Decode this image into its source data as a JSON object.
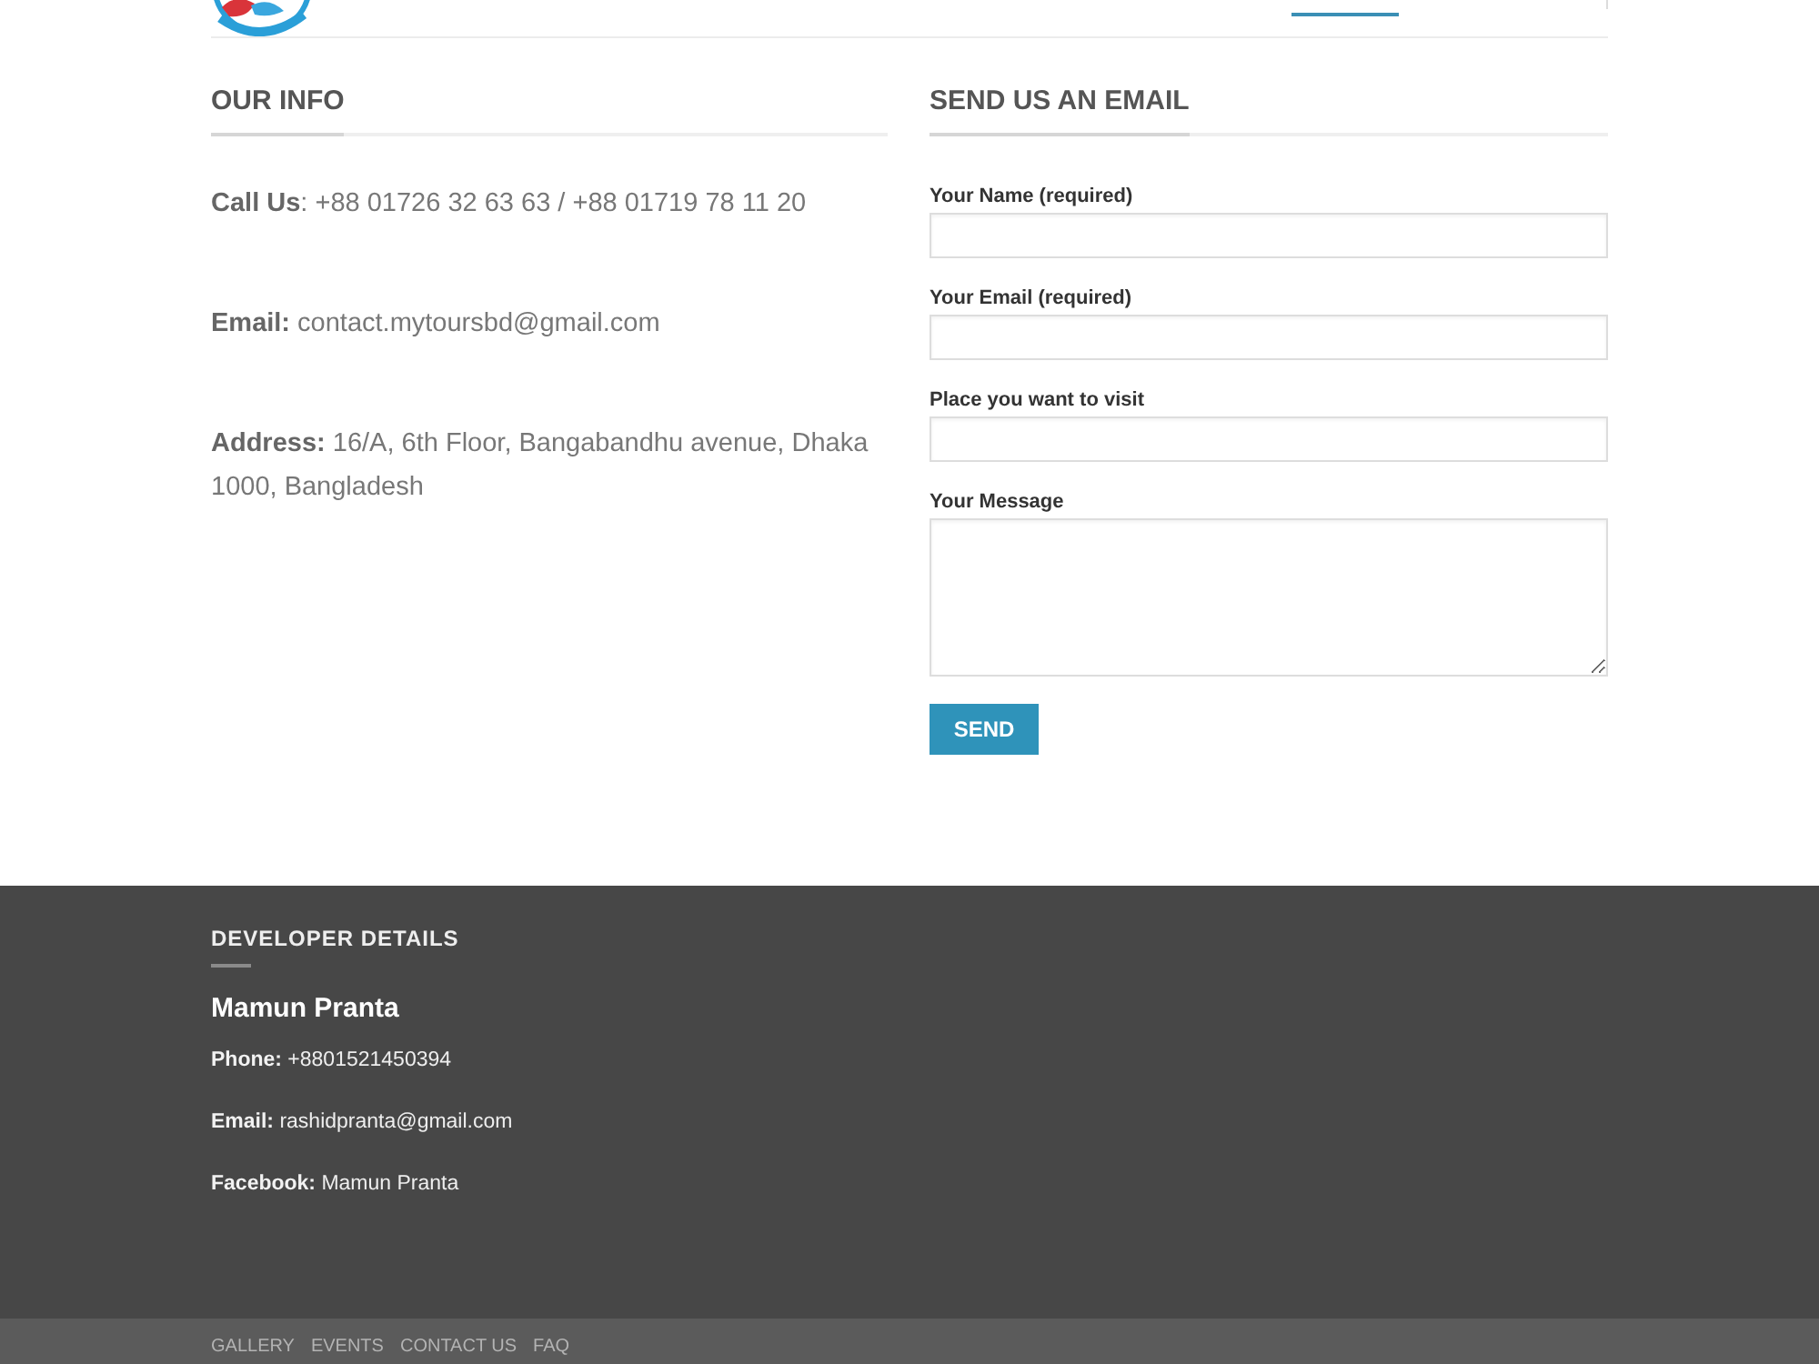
{
  "our_info": {
    "title": "OUR INFO",
    "lines": [
      "**Call Us**: +88 01726 32 63 63 / +88 01719 78 11 20",
      "**Email:** contact.mytoursbd@gmail.com",
      "**Address:** 16/A, 6th Floor, Bangabandhu avenue, Dhaka 1000, Bangladesh"
    ]
  },
  "email_form": {
    "title": "SEND US AN EMAIL",
    "fields": [
      {
        "label": "Your Name (required)",
        "kind": "text"
      },
      {
        "label": "Your Email (required)",
        "kind": "text"
      },
      {
        "label": "Place you want to visit",
        "kind": "text"
      },
      {
        "label": "Your Message",
        "kind": "textarea"
      }
    ],
    "submit": "SEND"
  },
  "footer": {
    "title": "DEVELOPER DETAILS",
    "name": "Mamun Pranta",
    "lines": [
      "**Phone:** +8801521450394",
      "**Email:** rashidpranta@gmail.com",
      "**Facebook:** Mamun Pranta"
    ]
  },
  "bottom_links": [
    "GALLERY",
    "EVENTS",
    "CONTACT US",
    "FAQ"
  ]
}
